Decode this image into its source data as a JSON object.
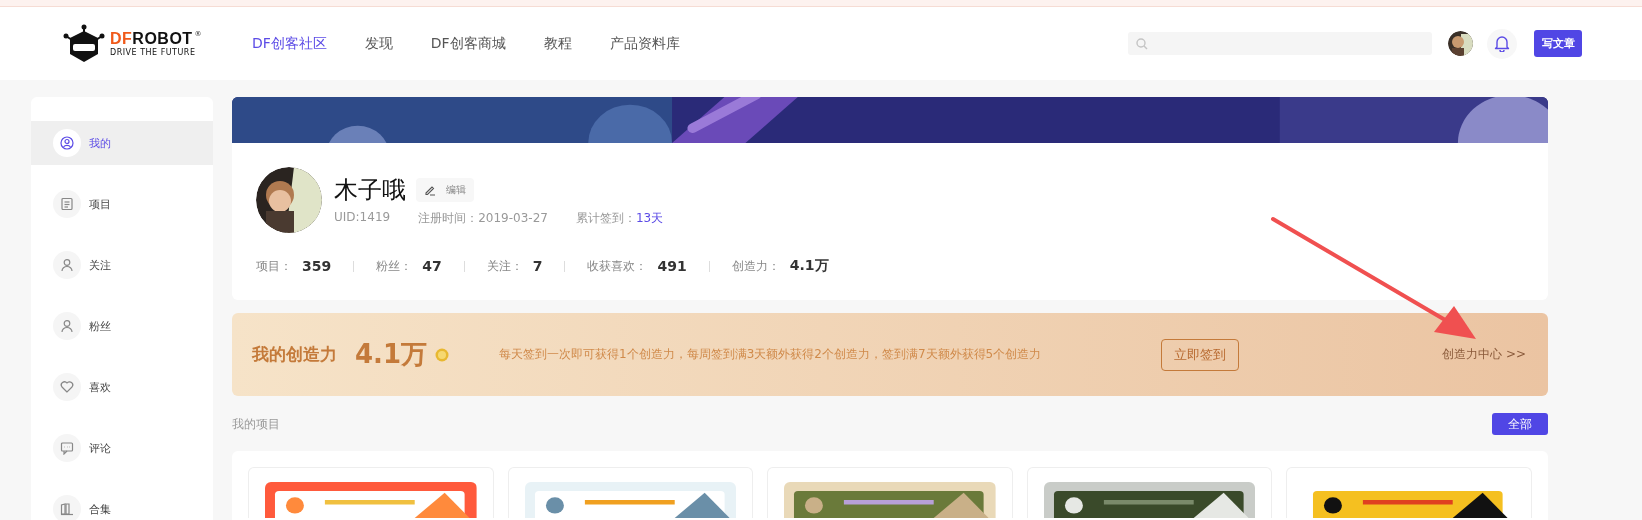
{
  "header": {
    "logo": {
      "brand_accent": "DF",
      "brand": "ROBOT",
      "registered_mark": "®",
      "tagline": "DRIVE THE FUTURE"
    },
    "nav": [
      {
        "label": "DF创客社区",
        "selected": true
      },
      {
        "label": "发现",
        "selected": false
      },
      {
        "label": "DF创客商城",
        "selected": false
      },
      {
        "label": "教程",
        "selected": false
      },
      {
        "label": "产品资料库",
        "selected": false
      }
    ],
    "write_button": "写文章"
  },
  "sidebar": {
    "items": [
      {
        "label": "我的",
        "selected": true
      },
      {
        "label": "项目",
        "selected": false
      },
      {
        "label": "关注",
        "selected": false
      },
      {
        "label": "粉丝",
        "selected": false
      },
      {
        "label": "喜欢",
        "selected": false
      },
      {
        "label": "评论",
        "selected": false
      },
      {
        "label": "合集",
        "selected": false
      }
    ]
  },
  "profile": {
    "name": "木子哦",
    "edit_button": "编辑",
    "uid": "UID:1419",
    "registered": "注册时间：2019-03-27",
    "checkin_label": "累计签到：",
    "checkin_days": "13天",
    "stats": [
      {
        "label": "项目：",
        "value": "359"
      },
      {
        "label": "粉丝：",
        "value": "47"
      },
      {
        "label": "关注：",
        "value": "7"
      },
      {
        "label": "收获喜欢：",
        "value": "491"
      },
      {
        "label": "创造力：",
        "value": "4.1万"
      }
    ]
  },
  "creativity": {
    "title": "我的创造力",
    "value": "4.1万",
    "description": "每天签到一次即可获得1个创造力，每周签到满3天额外获得2个创造力，签到满7天额外获得5个创造力",
    "checkin_button": "立即签到",
    "center_link": "创造力中心 >>"
  },
  "projects": {
    "title": "我的项目",
    "all_button": "全部"
  }
}
